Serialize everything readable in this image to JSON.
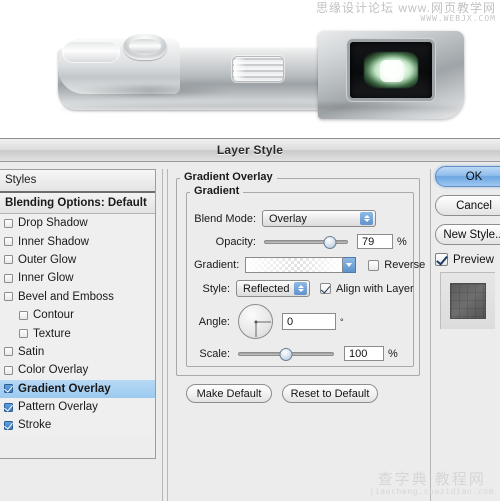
{
  "watermarks": {
    "top_line1": "思缘设计论坛 www.网页教学网",
    "top_line2": "WWW.WEBJX.COM",
    "bottom_line1": "查字典 教程网",
    "bottom_line2": "jiaocheng.chazidian.com"
  },
  "photo": {
    "alt": "silver digital camera top view with viewfinder"
  },
  "dialog": {
    "title": "Layer Style"
  },
  "styles_panel": {
    "header": "Styles",
    "blending_options": "Blending Options: Default",
    "effects": [
      {
        "label": "Drop Shadow",
        "checked": false,
        "indent": false,
        "selected": false
      },
      {
        "label": "Inner Shadow",
        "checked": false,
        "indent": false,
        "selected": false
      },
      {
        "label": "Outer Glow",
        "checked": false,
        "indent": false,
        "selected": false
      },
      {
        "label": "Inner Glow",
        "checked": false,
        "indent": false,
        "selected": false
      },
      {
        "label": "Bevel and Emboss",
        "checked": false,
        "indent": false,
        "selected": false
      },
      {
        "label": "Contour",
        "checked": false,
        "indent": true,
        "selected": false
      },
      {
        "label": "Texture",
        "checked": false,
        "indent": true,
        "selected": false
      },
      {
        "label": "Satin",
        "checked": false,
        "indent": false,
        "selected": false
      },
      {
        "label": "Color Overlay",
        "checked": false,
        "indent": false,
        "selected": false
      },
      {
        "label": "Gradient Overlay",
        "checked": true,
        "indent": false,
        "selected": true
      },
      {
        "label": "Pattern Overlay",
        "checked": true,
        "indent": false,
        "selected": false
      },
      {
        "label": "Stroke",
        "checked": true,
        "indent": false,
        "selected": false
      }
    ]
  },
  "main_panel": {
    "group_title": "Gradient Overlay",
    "subgroup_title": "Gradient",
    "blend_mode": {
      "label": "Blend Mode:",
      "value": "Overlay"
    },
    "opacity": {
      "label": "Opacity:",
      "value": "79",
      "unit": "%",
      "percent": 79
    },
    "gradient": {
      "label": "Gradient:",
      "reverse_label": "Reverse",
      "reverse_checked": false
    },
    "style": {
      "label": "Style:",
      "value": "Reflected",
      "align_label": "Align with Layer",
      "align_checked": true
    },
    "angle": {
      "label": "Angle:",
      "value": "0",
      "unit": "°"
    },
    "scale": {
      "label": "Scale:",
      "value": "100",
      "unit": "%",
      "percent": 50
    },
    "make_default": "Make Default",
    "reset_default": "Reset to Default"
  },
  "buttons": {
    "ok": "OK",
    "cancel": "Cancel",
    "new_style": "New Style...",
    "preview_label": "Preview",
    "preview_checked": true
  },
  "colors": {
    "accent": "#8fbdec",
    "selection": "#9ccaf0",
    "dialog_bg": "#ececec",
    "border": "#a9a9a9"
  }
}
